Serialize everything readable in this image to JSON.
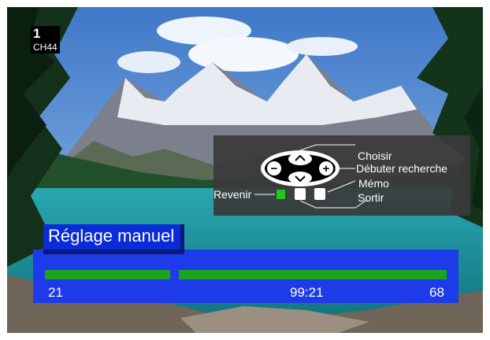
{
  "channel": {
    "number": "1",
    "label": "CH44"
  },
  "help": {
    "choose": "Choisir",
    "start_search": "Débuter recherche",
    "back": "Revenir",
    "memo": "Mémo",
    "exit": "Sortir",
    "minus": "−",
    "plus": "+"
  },
  "menu": {
    "title": "Réglage manuel"
  },
  "tuning": {
    "left_value": "21",
    "center_value": "99:21",
    "right_value": "68",
    "bar_color": "#1ba51b"
  },
  "colors": {
    "panel": "#1e3bea",
    "title_bg": "#0a2bd8",
    "help_bg": "#3a3a3a",
    "back_button": "#1ec81e"
  }
}
